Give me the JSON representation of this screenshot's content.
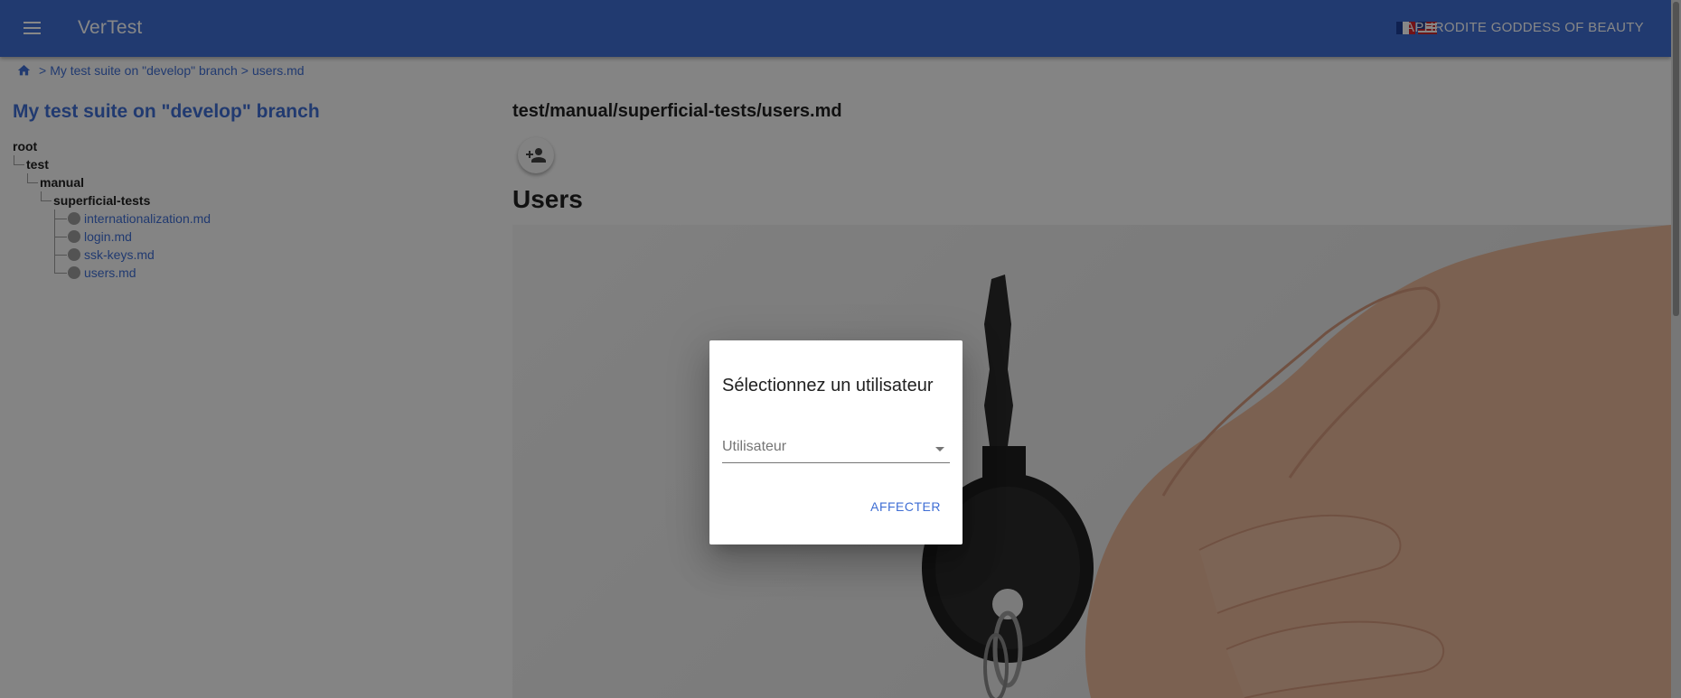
{
  "appbar": {
    "title": "VerTest",
    "flags": [
      "flag-fr-icon",
      "flag-us-icon"
    ],
    "user_name": "APHRODITE GODDESS OF BEAUTY"
  },
  "breadcrumb": {
    "separator": ">",
    "items": [
      "My test suite on \"develop\" branch",
      "users.md"
    ]
  },
  "sidebar": {
    "suite_title": "My test suite on \"develop\" branch",
    "tree": {
      "root": "root",
      "test": "test",
      "manual": "manual",
      "superficial": "superficial-tests",
      "files": [
        "internationalization.md",
        "login.md",
        "ssk-keys.md",
        "users.md"
      ]
    }
  },
  "main": {
    "file_path": "test/manual/superficial-tests/users.md",
    "heading": "Users"
  },
  "dialog": {
    "title": "Sélectionnez un utilisateur",
    "select_label": "Utilisateur",
    "assign_label": "AFFECTER"
  },
  "colors": {
    "primary": "#3f6ed4",
    "overlay": "rgba(0,0,0,0.47)"
  }
}
